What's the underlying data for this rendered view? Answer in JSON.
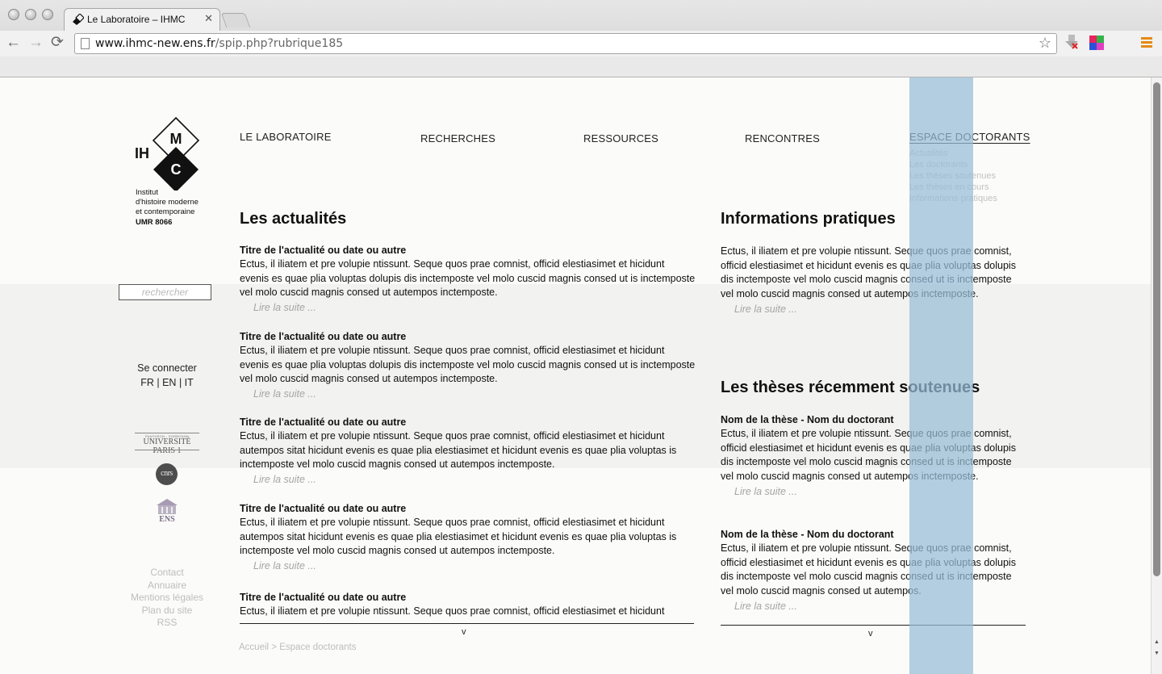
{
  "browser": {
    "tab_title": "Le Laboratoire – IHMC",
    "tab_close": "✕",
    "url_host": "www.ihmc-new.ens.fr",
    "url_path": "/spip.php?rubrique185",
    "back": "←",
    "forward": "→",
    "reload": "⟳",
    "star": "☆"
  },
  "logo": {
    "letters_ih": "IH",
    "letter_m": "M",
    "letter_c": "C",
    "line1": "Institut",
    "line2": "d'histoire moderne",
    "line3": "et contemporaine",
    "umr": "UMR 8066"
  },
  "nav": {
    "items": [
      "LE LABORATOIRE",
      "RECHERCHES",
      "RESSOURCES",
      "RENCONTRES",
      "ESPACE DOCTORANTS"
    ],
    "active": "ESPACE DOCTORANTS",
    "subitems": [
      "Actualités",
      "Les doctorants",
      "Les thèses soutenues",
      "Les thèses en cours",
      "Informations pratiques"
    ]
  },
  "sidebar": {
    "search_placeholder": "rechercher",
    "login": "Se connecter",
    "lang_fr": "FR",
    "lang_en": "EN",
    "lang_it": "IT",
    "lang_sep": " | ",
    "partners": {
      "p1_small": "PANTHÉON - SORBONNE",
      "p1_name": "UNIVERSITÉ PARIS 1",
      "cnrs": "cnrs",
      "ens": "ENS"
    },
    "footer_links": [
      "Contact",
      "Annuaire",
      "Mentions légales",
      "Plan du site",
      "RSS"
    ]
  },
  "news": {
    "heading": "Les actualités",
    "items": [
      {
        "title": "Titre de l'actualité ou date ou autre",
        "text": "Ectus, il iliatem et pre volupie ntissunt. Seque quos prae comnist, officid elestiasimet et hicidunt evenis es quae plia voluptas dolupis dis inctemposte vel molo cuscid magnis consed ut is inctemposte vel molo cuscid magnis consed ut autempos inctemposte.",
        "more": "Lire la suite ..."
      },
      {
        "title": "Titre de l'actualité ou date ou autre",
        "text": "Ectus, il iliatem et pre volupie ntissunt. Seque quos prae comnist, officid elestiasimet et hicidunt evenis es quae plia voluptas dolupis dis inctemposte vel molo cuscid magnis consed ut is inctemposte vel molo cuscid magnis consed ut autempos inctemposte.",
        "more": "Lire la suite ..."
      },
      {
        "title": "Titre de l'actualité ou date ou autre",
        "text": "Ectus, il iliatem et pre volupie ntissunt. Seque quos prae comnist, officid elestiasimet et hicidunt autempos sitat hicidunt evenis es quae plia elestiasimet et hicidunt evenis es quae plia voluptas is inctemposte vel molo cuscid magnis consed ut autempos inctemposte.",
        "more": "Lire la suite ..."
      },
      {
        "title": "Titre de l'actualité ou date ou autre",
        "text": "Ectus, il iliatem et pre volupie ntissunt. Seque quos prae comnist, officid elestiasimet et hicidunt autempos sitat hicidunt evenis es quae plia elestiasimet et hicidunt evenis es quae plia voluptas is inctemposte vel molo cuscid magnis consed ut autempos inctemposte.",
        "more": "Lire la suite ..."
      },
      {
        "title": "Titre de l'actualité ou date ou autre",
        "text": "Ectus, il iliatem et pre volupie ntissunt. Seque quos prae comnist, officid elestiasimet et hicidunt"
      }
    ],
    "expand": "v"
  },
  "info": {
    "heading": "Informations pratiques",
    "text": "Ectus, il iliatem et pre volupie ntissunt. Seque quos prae comnist, officid elestiasimet et hicidunt evenis es quae plia voluptas dolupis dis inctemposte vel molo cuscid magnis consed ut is inctemposte vel molo cuscid magnis consed ut autempos inctemposte.",
    "more": "Lire la suite ..."
  },
  "theses": {
    "heading": "Les thèses récemment soutenues",
    "items": [
      {
        "title": "Nom de la thèse - Nom du doctorant",
        "text": "Ectus, il iliatem et pre volupie ntissunt. Seque quos prae comnist, officid elestiasimet et hicidunt evenis es quae plia voluptas dolupis dis inctemposte vel molo cuscid magnis consed ut is inctemposte vel molo cuscid magnis consed ut autempos inctemposte.",
        "more": "Lire la suite ..."
      },
      {
        "title": "Nom de la thèse - Nom du doctorant",
        "text": "Ectus, il iliatem et pre volupie ntissunt. Seque quos prae comnist, officid elestiasimet et hicidunt evenis es quae plia voluptas dolupis dis inctemposte vel molo cuscid magnis consed ut is inctemposte vel molo cuscid magnis consed ut autempos.",
        "more": "Lire la suite ..."
      }
    ],
    "expand": "v"
  },
  "breadcrumb": {
    "home": "Accueil",
    "sep": " > ",
    "current": "Espace doctorants"
  },
  "colors": {
    "accent_column": "#96bcd6",
    "menu_icon": "#e48a14",
    "muted_text": "#bdbdbd"
  }
}
